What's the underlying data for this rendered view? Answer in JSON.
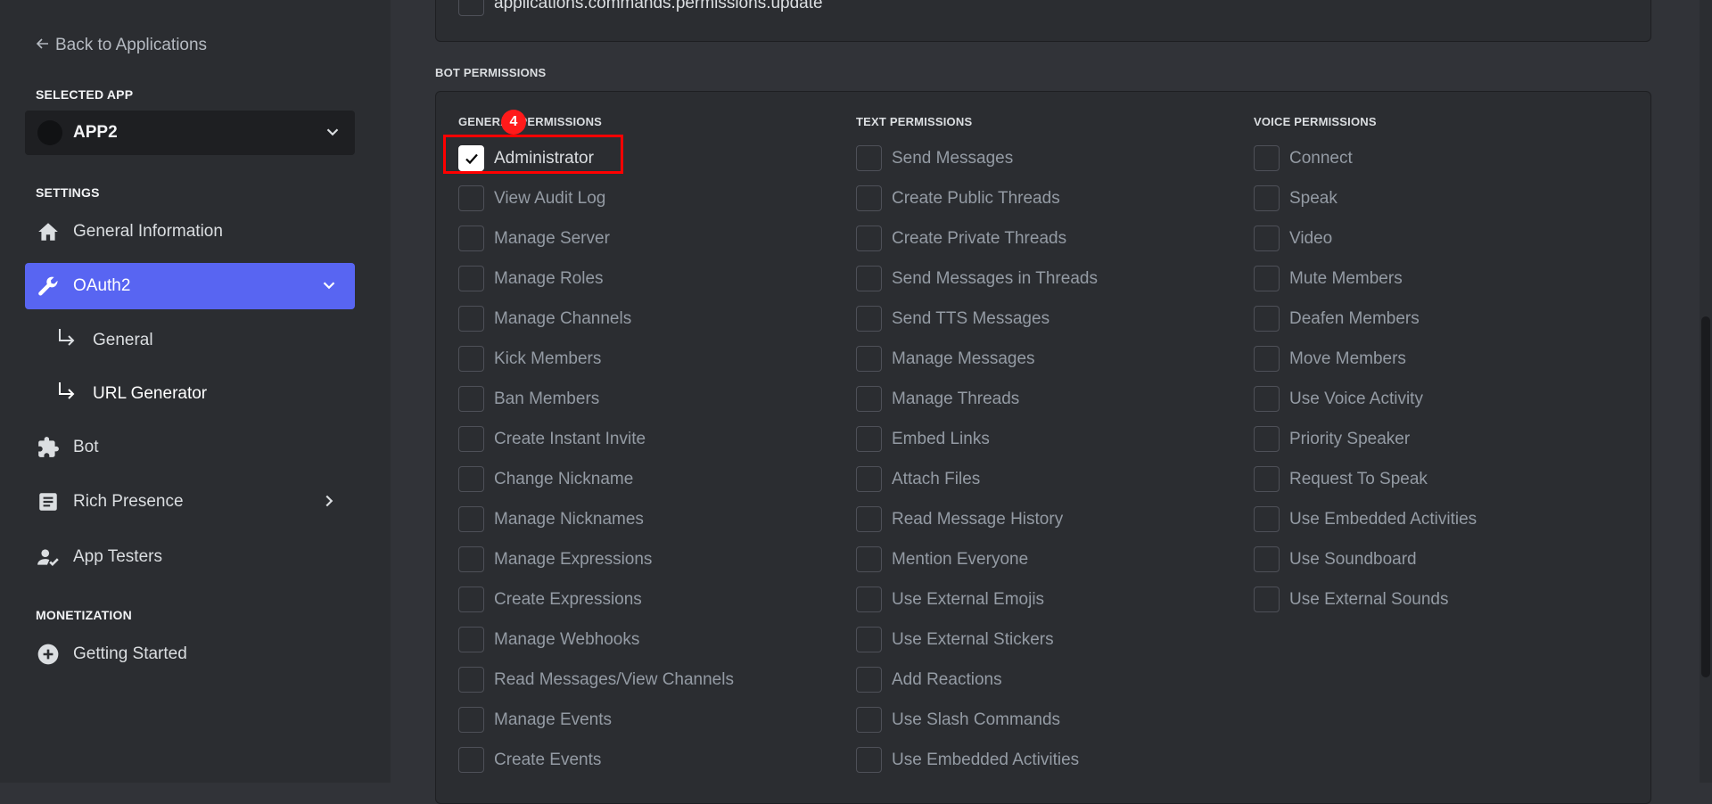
{
  "sidebar": {
    "back_label": "Back to Applications",
    "selected_app_label": "SELECTED APP",
    "app_name": "APP2",
    "settings_label": "SETTINGS",
    "monetization_label": "MONETIZATION",
    "items": {
      "general_information": "General Information",
      "oauth2": "OAuth2",
      "oauth2_general": "General",
      "oauth2_url_generator": "URL Generator",
      "bot": "Bot",
      "rich_presence": "Rich Presence",
      "app_testers": "App Testers",
      "getting_started": "Getting Started"
    }
  },
  "scopes": {
    "last_visible": "applications.commands.permissions.update"
  },
  "bot_permissions": {
    "heading": "BOT PERMISSIONS",
    "annotation_badge": "4",
    "general": {
      "heading": "GENERAL PERMISSIONS",
      "items": [
        {
          "label": "Administrator",
          "checked": true
        },
        {
          "label": "View Audit Log",
          "checked": false
        },
        {
          "label": "Manage Server",
          "checked": false
        },
        {
          "label": "Manage Roles",
          "checked": false
        },
        {
          "label": "Manage Channels",
          "checked": false
        },
        {
          "label": "Kick Members",
          "checked": false
        },
        {
          "label": "Ban Members",
          "checked": false
        },
        {
          "label": "Create Instant Invite",
          "checked": false
        },
        {
          "label": "Change Nickname",
          "checked": false
        },
        {
          "label": "Manage Nicknames",
          "checked": false
        },
        {
          "label": "Manage Expressions",
          "checked": false
        },
        {
          "label": "Create Expressions",
          "checked": false
        },
        {
          "label": "Manage Webhooks",
          "checked": false
        },
        {
          "label": "Read Messages/View Channels",
          "checked": false
        },
        {
          "label": "Manage Events",
          "checked": false
        },
        {
          "label": "Create Events",
          "checked": false
        }
      ]
    },
    "text": {
      "heading": "TEXT PERMISSIONS",
      "items": [
        {
          "label": "Send Messages",
          "checked": false
        },
        {
          "label": "Create Public Threads",
          "checked": false
        },
        {
          "label": "Create Private Threads",
          "checked": false
        },
        {
          "label": "Send Messages in Threads",
          "checked": false
        },
        {
          "label": "Send TTS Messages",
          "checked": false
        },
        {
          "label": "Manage Messages",
          "checked": false
        },
        {
          "label": "Manage Threads",
          "checked": false
        },
        {
          "label": "Embed Links",
          "checked": false
        },
        {
          "label": "Attach Files",
          "checked": false
        },
        {
          "label": "Read Message History",
          "checked": false
        },
        {
          "label": "Mention Everyone",
          "checked": false
        },
        {
          "label": "Use External Emojis",
          "checked": false
        },
        {
          "label": "Use External Stickers",
          "checked": false
        },
        {
          "label": "Add Reactions",
          "checked": false
        },
        {
          "label": "Use Slash Commands",
          "checked": false
        },
        {
          "label": "Use Embedded Activities",
          "checked": false
        }
      ]
    },
    "voice": {
      "heading": "VOICE PERMISSIONS",
      "items": [
        {
          "label": "Connect",
          "checked": false
        },
        {
          "label": "Speak",
          "checked": false
        },
        {
          "label": "Video",
          "checked": false
        },
        {
          "label": "Mute Members",
          "checked": false
        },
        {
          "label": "Deafen Members",
          "checked": false
        },
        {
          "label": "Move Members",
          "checked": false
        },
        {
          "label": "Use Voice Activity",
          "checked": false
        },
        {
          "label": "Priority Speaker",
          "checked": false
        },
        {
          "label": "Request To Speak",
          "checked": false
        },
        {
          "label": "Use Embedded Activities",
          "checked": false
        },
        {
          "label": "Use Soundboard",
          "checked": false
        },
        {
          "label": "Use External Sounds",
          "checked": false
        }
      ]
    }
  },
  "colors": {
    "accent": "#5865f2",
    "annotation": "#ff0000"
  }
}
